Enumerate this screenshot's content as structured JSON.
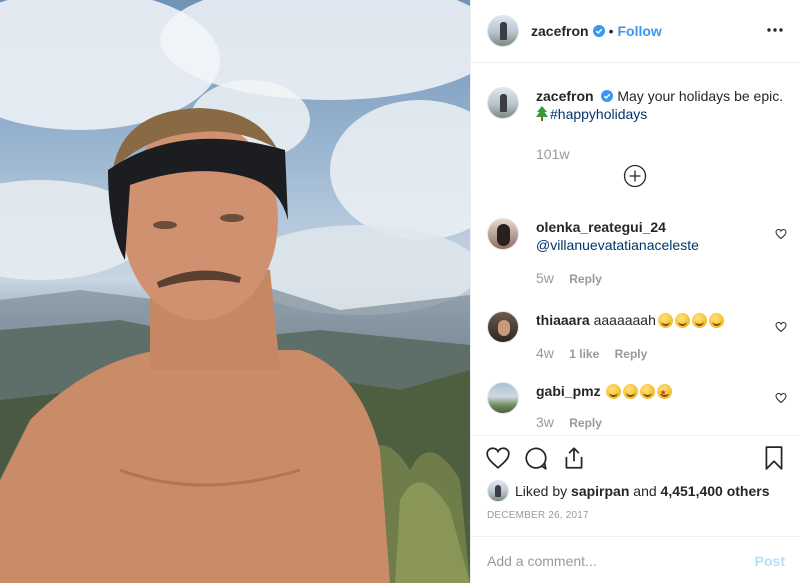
{
  "header": {
    "username": "zacefron",
    "follow_label": "Follow",
    "separator": "•"
  },
  "caption": {
    "username": "zacefron",
    "text": "May your holidays be epic.",
    "hashtag": "#happyholidays",
    "age": "101w"
  },
  "comments": [
    {
      "username": "olenka_reategui_24",
      "text": "@villanuevatatianaceleste",
      "age": "5w",
      "likes": "",
      "reply_label": "Reply"
    },
    {
      "username": "thiaaara",
      "text": "aaaaaaah",
      "age": "4w",
      "likes": "1 like",
      "reply_label": "Reply"
    },
    {
      "username": "gabi_pmz",
      "text": "",
      "age": "3w",
      "likes": "",
      "reply_label": "Reply"
    }
  ],
  "likes": {
    "prefix": "Liked by",
    "user": "sapirpan",
    "and": "and",
    "others": "4,451,400 others"
  },
  "date": "December 26, 2017",
  "add_comment": {
    "placeholder": "Add a comment...",
    "post_label": "Post"
  },
  "icons": [
    "verified-icon",
    "more-icon",
    "add-circle-icon",
    "heart-icon",
    "comment-icon",
    "share-icon",
    "bookmark-icon",
    "tree-emoji",
    "grin-emoji",
    "heart-eyes-emoji"
  ],
  "colors": {
    "link": "#3897f0",
    "muted": "#999999",
    "border": "#efefef",
    "post_disabled": "#b2dffc",
    "hashtag": "#003569"
  }
}
